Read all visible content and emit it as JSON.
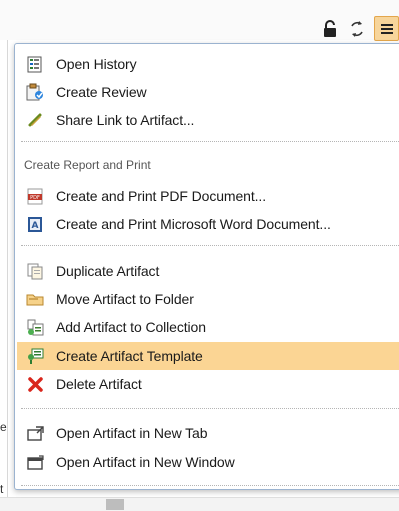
{
  "toolbar": {
    "lock_icon": "lock-icon",
    "sync_icon": "sync-icon",
    "menu_icon": "hamburger-menu-icon"
  },
  "menu": {
    "group1": [
      {
        "label": "Open History",
        "icon": "history-icon"
      },
      {
        "label": "Create Review",
        "icon": "review-icon"
      },
      {
        "label": "Share Link to Artifact...",
        "icon": "link-icon"
      }
    ],
    "report_header": "Create Report and Print",
    "group2": [
      {
        "label": "Create and Print PDF Document...",
        "icon": "pdf-icon"
      },
      {
        "label": "Create and Print Microsoft Word Document...",
        "icon": "word-icon"
      }
    ],
    "group3": [
      {
        "label": "Duplicate Artifact",
        "icon": "duplicate-icon"
      },
      {
        "label": "Move Artifact to Folder",
        "icon": "folder-move-icon"
      },
      {
        "label": "Add Artifact to Collection",
        "icon": "collection-icon"
      },
      {
        "label": "Create Artifact Template",
        "icon": "template-icon",
        "active": true
      },
      {
        "label": "Delete Artifact",
        "icon": "delete-icon"
      }
    ],
    "group4": [
      {
        "label": "Open Artifact in New Tab",
        "icon": "new-tab-icon"
      },
      {
        "label": "Open Artifact in New Window",
        "icon": "new-window-icon"
      }
    ]
  },
  "colors": {
    "highlight": "#fbd594",
    "menu_button": "#f7d59b",
    "delete": "#d9261c",
    "pdf": "#c0392b",
    "word": "#2b5797"
  }
}
